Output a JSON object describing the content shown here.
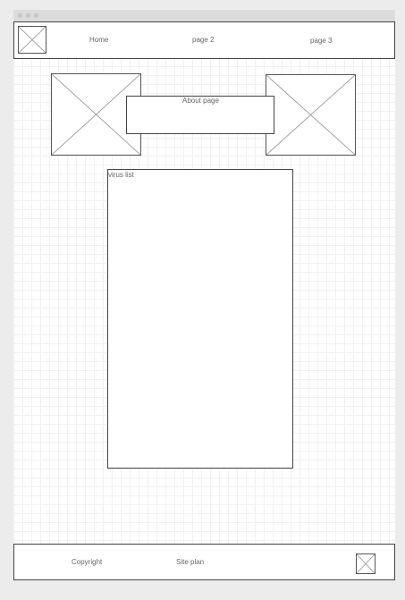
{
  "header": {
    "logo_icon": "image-placeholder-icon",
    "nav": {
      "home": "Home",
      "page2": "page 2",
      "page3": "page 3"
    }
  },
  "main": {
    "left_image_icon": "image-placeholder-icon",
    "right_image_icon": "image-placeholder-icon",
    "about_label": "About page",
    "virus_list_label": "virus list"
  },
  "footer": {
    "copyright": "Copyright",
    "site_plan": "Site plan",
    "footer_image_icon": "image-placeholder-icon"
  },
  "colors": {
    "border": "#444444",
    "placeholder_cross": "#a0a0a0",
    "grid": "#f1f1f1",
    "background": "#ececec"
  }
}
